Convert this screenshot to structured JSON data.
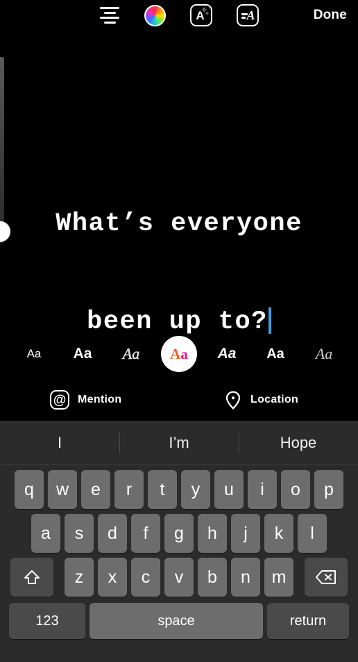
{
  "topbar": {
    "align_icon": "text-align-center-icon",
    "color_icon": "color-wheel-icon",
    "effects_icon": "text-effects-icon",
    "animate_icon": "text-animation-icon",
    "done_label": "Done"
  },
  "size_slider": {
    "name": "text-size-slider",
    "value": 12
  },
  "story": {
    "text_line1": "What’s everyone",
    "text_line2": "been up to?",
    "caret_color": "#3f9fe0",
    "text_color": "#ffffff"
  },
  "fonts": {
    "options": [
      {
        "label": "Aa",
        "style": "classic",
        "selected": false
      },
      {
        "label": "Aa",
        "style": "modern",
        "selected": false
      },
      {
        "label": "Aa",
        "style": "neon-script",
        "selected": false
      },
      {
        "label": "Aa",
        "style": "typewriter",
        "selected": true,
        "color_a": "#f26122",
        "color_a2": "#e5197f"
      },
      {
        "label": "Aa",
        "style": "strong",
        "selected": false
      },
      {
        "label": "Aa",
        "style": "bold-round",
        "selected": false
      },
      {
        "label": "Aa",
        "style": "serif-italic",
        "selected": false
      }
    ]
  },
  "actions": {
    "mention_label": "Mention",
    "mention_icon": "at-sign-icon",
    "location_label": "Location",
    "location_icon": "map-pin-icon"
  },
  "keyboard": {
    "predictions": [
      "I",
      "I’m",
      "Hope"
    ],
    "row1": [
      "q",
      "w",
      "e",
      "r",
      "t",
      "y",
      "u",
      "i",
      "o",
      "p"
    ],
    "row2": [
      "a",
      "s",
      "d",
      "f",
      "g",
      "h",
      "j",
      "k",
      "l"
    ],
    "row3": [
      "z",
      "x",
      "c",
      "v",
      "b",
      "n",
      "m"
    ],
    "shift_icon": "shift-arrow-icon",
    "backspace_icon": "backspace-icon",
    "numbers_label": "123",
    "space_label": "space",
    "return_label": "return"
  }
}
